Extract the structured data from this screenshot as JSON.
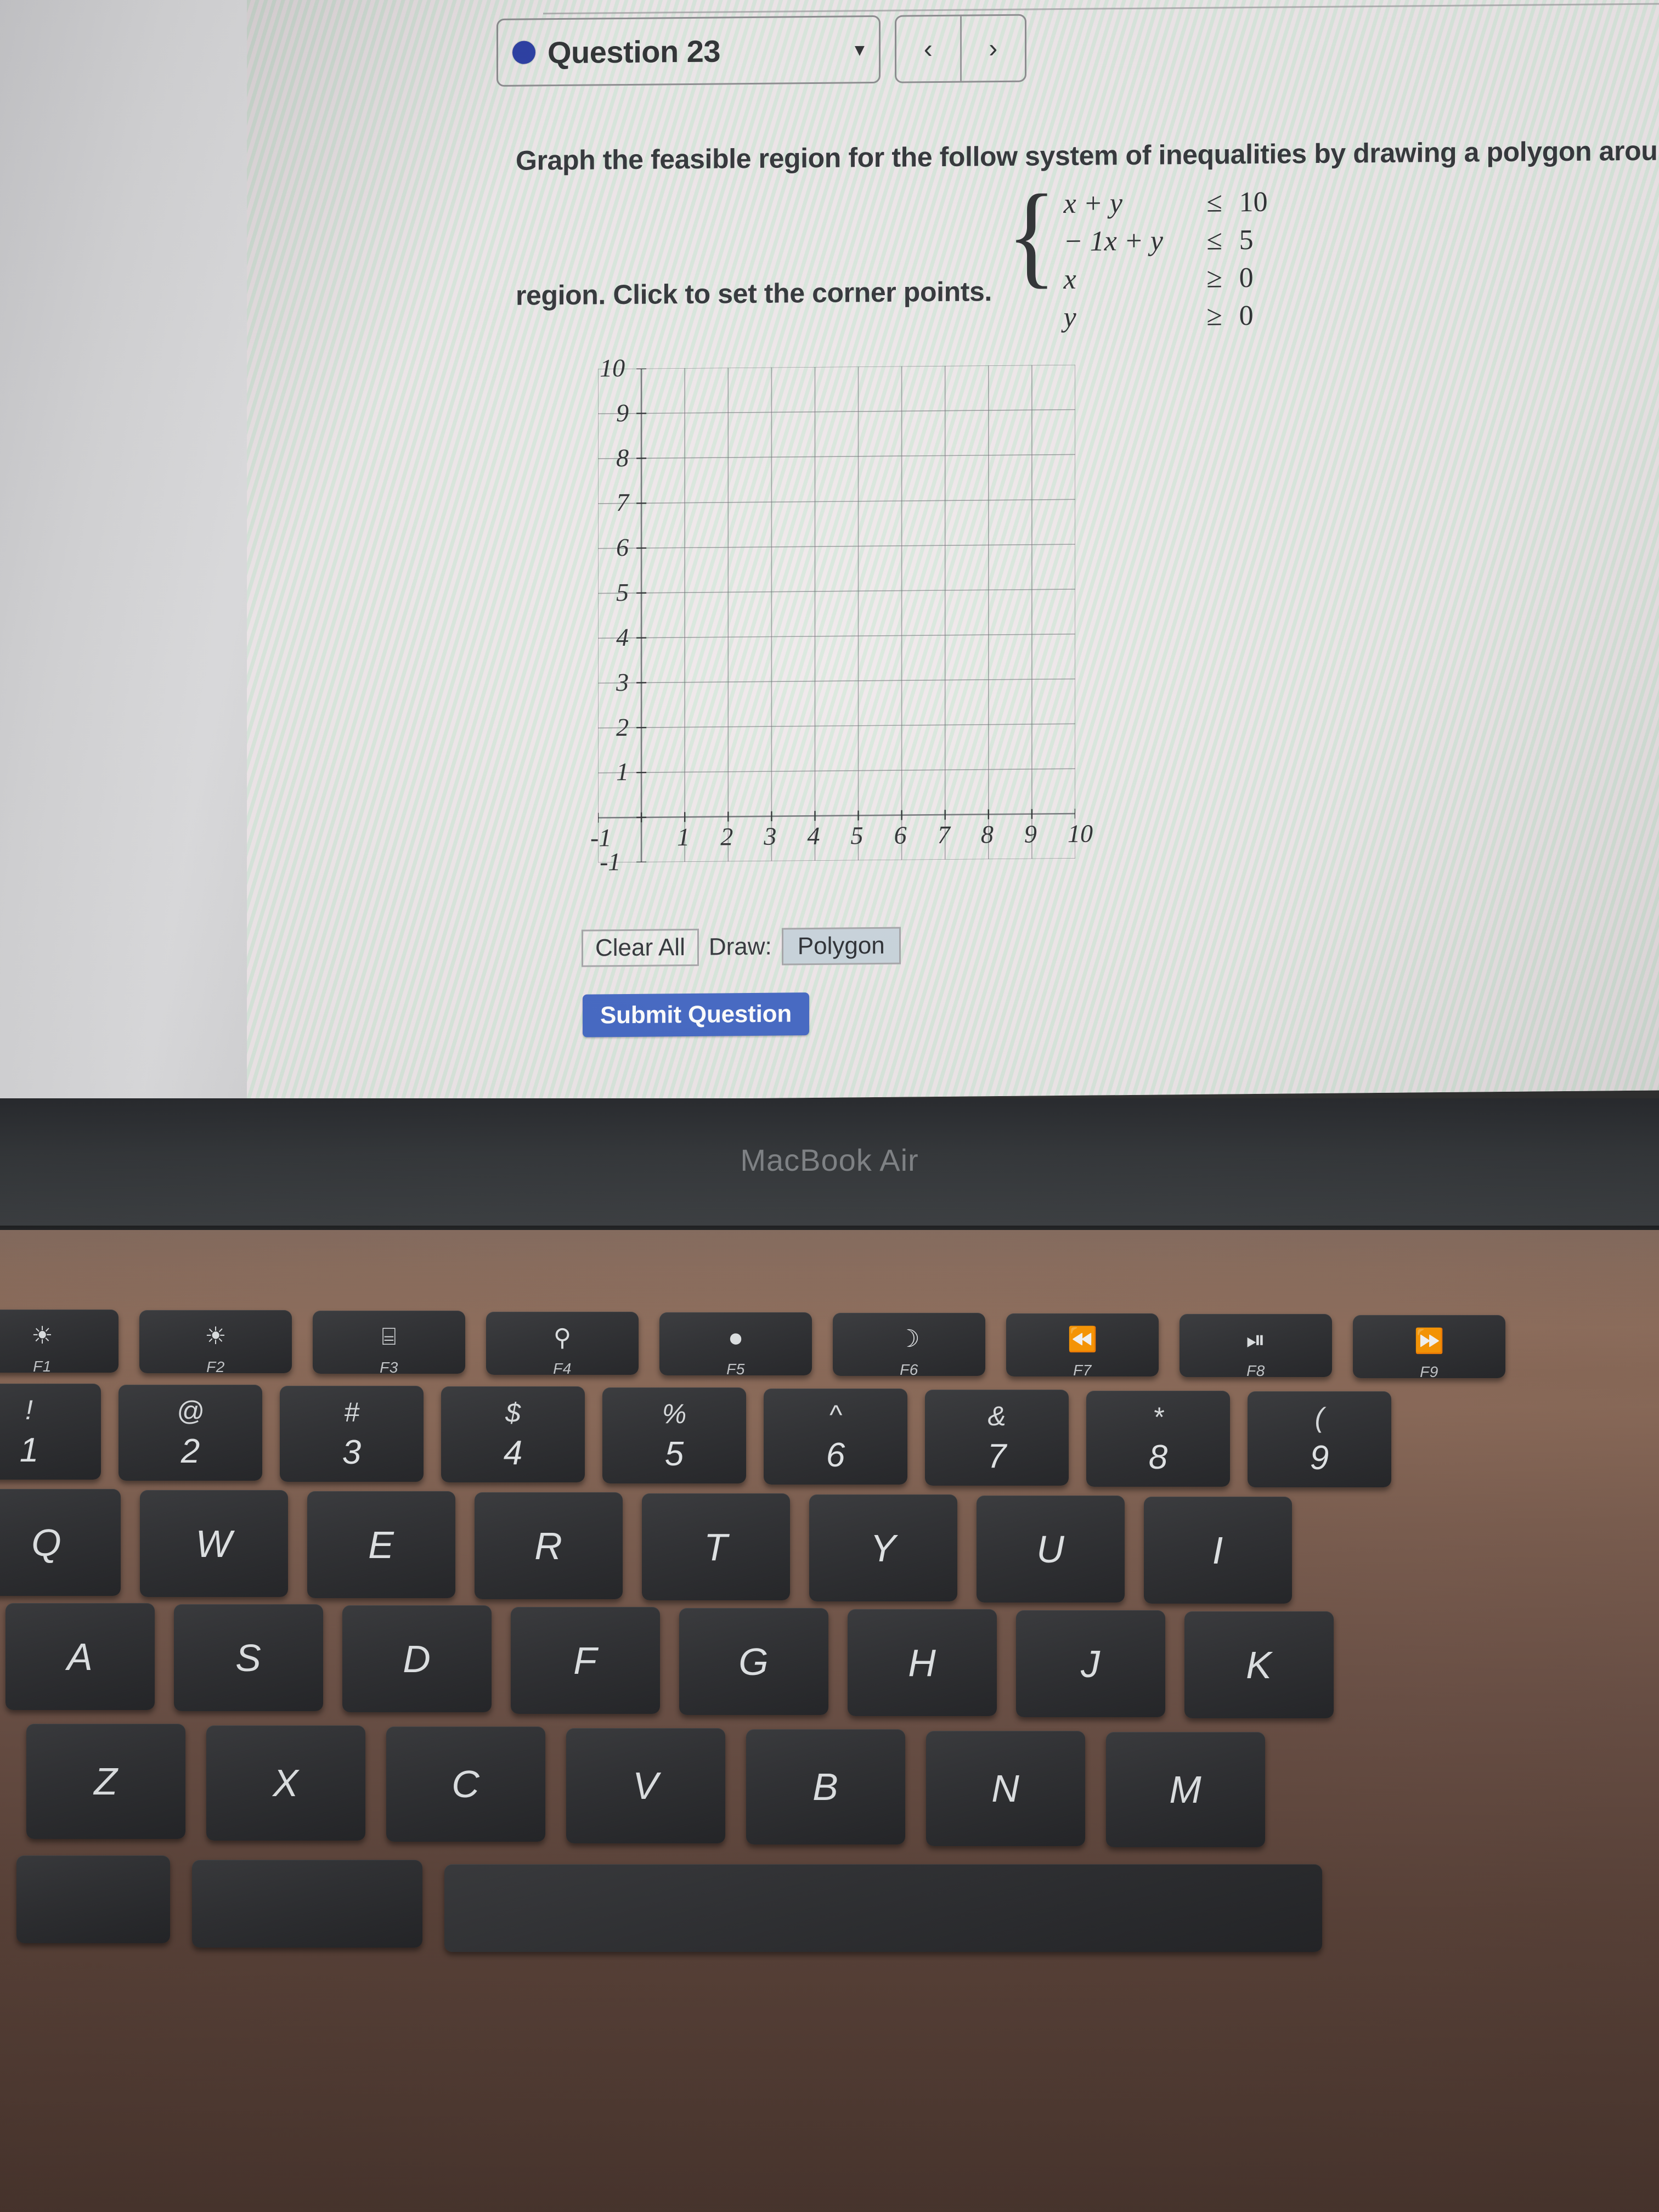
{
  "question_header": {
    "dot_color": "#2b3fa8",
    "title": "Question 23",
    "caret_icon": "chevron-down-icon",
    "prev_label": "‹",
    "next_label": "›"
  },
  "question": {
    "line1": "Graph the feasible region for the follow system of inequalities by drawing a polygon around the feasible",
    "line2": "region. Click to set the corner points.",
    "brace": "{",
    "inequalities": [
      {
        "lhs": "x + y",
        "rel": "≤",
        "rhs": "10"
      },
      {
        "lhs": "− 1x + y",
        "rel": "≤",
        "rhs": "5"
      },
      {
        "lhs": "x",
        "rel": "≥",
        "rhs": "0"
      },
      {
        "lhs": "y",
        "rel": "≥",
        "rhs": "0"
      }
    ]
  },
  "chart_data": {
    "type": "scatter",
    "title": "",
    "xlabel": "",
    "ylabel": "",
    "xlim": [
      -1,
      10
    ],
    "ylim": [
      -1,
      10
    ],
    "grid": true,
    "x_ticks": [
      "-1",
      "1",
      "2",
      "3",
      "4",
      "5",
      "6",
      "7",
      "8",
      "9",
      "10"
    ],
    "y_ticks": [
      "10",
      "9",
      "8",
      "7",
      "6",
      "5",
      "4",
      "3",
      "2",
      "1",
      "-1"
    ],
    "x_tick_values": [
      -1,
      1,
      2,
      3,
      4,
      5,
      6,
      7,
      8,
      9,
      10
    ],
    "y_tick_values": [
      10,
      9,
      8,
      7,
      6,
      5,
      4,
      3,
      2,
      1,
      -1
    ],
    "series": [],
    "points": [],
    "polygon": [],
    "annotation": "empty graphing grid — no polygon drawn yet"
  },
  "graph_tools": {
    "clear_all": "Clear All",
    "draw_label": "Draw:",
    "draw_mode": "Polygon"
  },
  "submit": {
    "label": "Submit Question",
    "color": "#4367c4"
  },
  "cursor": {
    "icon": "mouse-pointer-icon"
  },
  "laptop": {
    "brand": "MacBook Air",
    "function_keys": [
      {
        "label": "F1",
        "icon": "brightness-down-icon",
        "glyph": "☀"
      },
      {
        "label": "F2",
        "icon": "brightness-up-icon",
        "glyph": "☀"
      },
      {
        "label": "F3",
        "icon": "mission-control-icon",
        "glyph": "⌸"
      },
      {
        "label": "F4",
        "icon": "spotlight-search-icon",
        "glyph": "⚲"
      },
      {
        "label": "F5",
        "icon": "dictation-mic-icon",
        "glyph": "⏺"
      },
      {
        "label": "F6",
        "icon": "do-not-disturb-moon-icon",
        "glyph": "☽"
      },
      {
        "label": "F7",
        "icon": "rewind-icon",
        "glyph": "⏪"
      },
      {
        "label": "F8",
        "icon": "play-pause-icon",
        "glyph": "⏯"
      },
      {
        "label": "F9",
        "icon": "fast-forward-icon",
        "glyph": "⏩"
      }
    ],
    "number_row": [
      {
        "sym": "!",
        "num": "1"
      },
      {
        "sym": "@",
        "num": "2"
      },
      {
        "sym": "#",
        "num": "3"
      },
      {
        "sym": "$",
        "num": "4"
      },
      {
        "sym": "%",
        "num": "5"
      },
      {
        "sym": "^",
        "num": "6"
      },
      {
        "sym": "&",
        "num": "7"
      },
      {
        "sym": "*",
        "num": "8"
      },
      {
        "sym": "(",
        "num": "9"
      }
    ],
    "row_q": [
      "Q",
      "W",
      "E",
      "R",
      "T",
      "Y",
      "U",
      "I"
    ],
    "row_a": [
      "A",
      "S",
      "D",
      "F",
      "G",
      "H",
      "J",
      "K"
    ],
    "row_z": [
      "Z",
      "X",
      "C",
      "V",
      "B",
      "N",
      "M"
    ]
  }
}
